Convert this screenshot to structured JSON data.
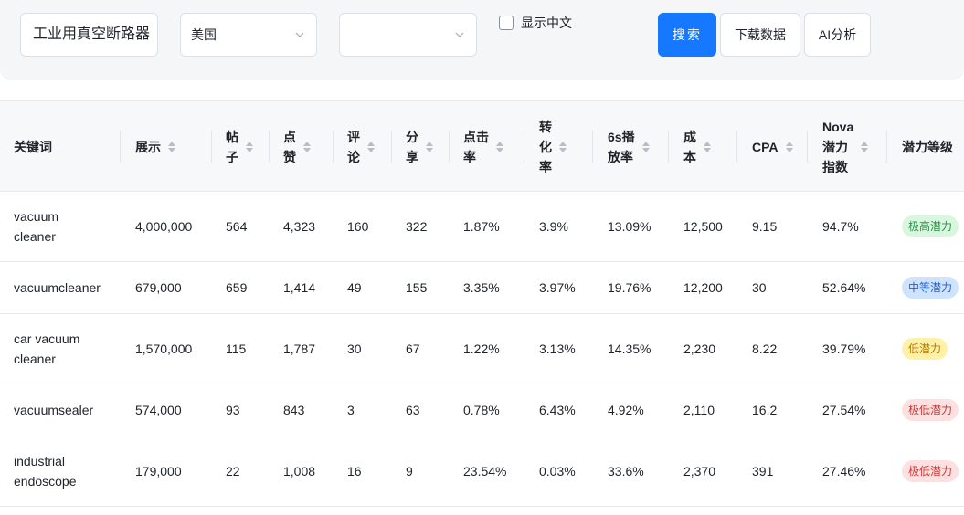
{
  "search": {
    "keyword_value": "工业用真空断路器",
    "country_value": "美国",
    "second_value": "",
    "show_chinese_label": "显示中文",
    "search_label": "搜索",
    "download_label": "下载数据",
    "ai_label": "AI分析"
  },
  "colors": {
    "primary": "#1677ff",
    "high": "#d9f7df",
    "medium": "#cfe3ff",
    "low": "#fff1a8",
    "very_low": "#fde0e0"
  },
  "table": {
    "headers": [
      {
        "label": "关键词",
        "sortable": false
      },
      {
        "label": "展示",
        "sortable": true
      },
      {
        "label": "帖\n子",
        "sortable": true
      },
      {
        "label": "点\n赞",
        "sortable": true
      },
      {
        "label": "评\n论",
        "sortable": true
      },
      {
        "label": "分\n享",
        "sortable": true
      },
      {
        "label": "点击\n率",
        "sortable": true
      },
      {
        "label": "转\n化\n率",
        "sortable": true
      },
      {
        "label": "6s播\n放率",
        "sortable": true
      },
      {
        "label": "成\n本",
        "sortable": true
      },
      {
        "label": "CPA",
        "sortable": true
      },
      {
        "label": "Nova\n潜力\n指数",
        "sortable": true
      },
      {
        "label": "潜力等级",
        "sortable": false
      }
    ],
    "rows": [
      {
        "keyword": "vacuum\ncleaner",
        "impressions": "4,000,000",
        "posts": "564",
        "likes": "4,323",
        "comments": "160",
        "shares": "322",
        "ctr": "1.87%",
        "cvr": "3.9%",
        "play6s": "13.09%",
        "cost": "12,500",
        "cpa": "9.15",
        "nova": "94.7%",
        "level": "极高潜力",
        "level_type": "green"
      },
      {
        "keyword": "vacuumcleaner",
        "impressions": "679,000",
        "posts": "659",
        "likes": "1,414",
        "comments": "49",
        "shares": "155",
        "ctr": "3.35%",
        "cvr": "3.97%",
        "play6s": "19.76%",
        "cost": "12,200",
        "cpa": "30",
        "nova": "52.64%",
        "level": "中等潜力",
        "level_type": "blue"
      },
      {
        "keyword": "car vacuum\ncleaner",
        "impressions": "1,570,000",
        "posts": "115",
        "likes": "1,787",
        "comments": "30",
        "shares": "67",
        "ctr": "1.22%",
        "cvr": "3.13%",
        "play6s": "14.35%",
        "cost": "2,230",
        "cpa": "8.22",
        "nova": "39.79%",
        "level": "低潜力",
        "level_type": "yellow"
      },
      {
        "keyword": "vacuumsealer",
        "impressions": "574,000",
        "posts": "93",
        "likes": "843",
        "comments": "3",
        "shares": "63",
        "ctr": "0.78%",
        "cvr": "6.43%",
        "play6s": "4.92%",
        "cost": "2,110",
        "cpa": "16.2",
        "nova": "27.54%",
        "level": "极低潜力",
        "level_type": "red"
      },
      {
        "keyword": "industrial\nendoscope",
        "impressions": "179,000",
        "posts": "22",
        "likes": "1,008",
        "comments": "16",
        "shares": "9",
        "ctr": "23.54%",
        "cvr": "0.03%",
        "play6s": "33.6%",
        "cost": "2,370",
        "cpa": "391",
        "nova": "27.46%",
        "level": "极低潜力",
        "level_type": "red"
      }
    ]
  }
}
